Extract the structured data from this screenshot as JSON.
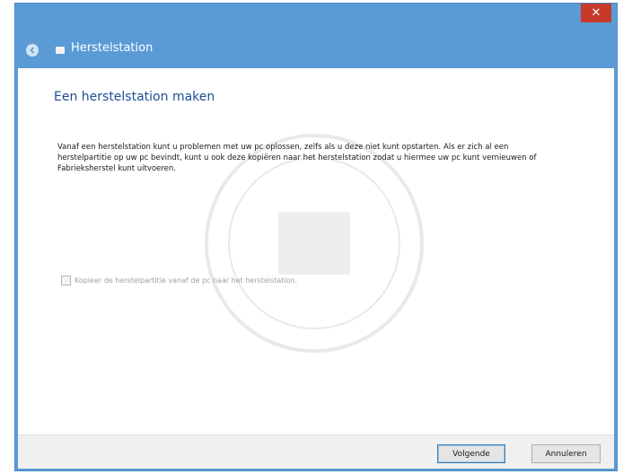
{
  "window": {
    "close_label": "✕"
  },
  "navbar": {
    "title": "Herstelstation",
    "back_icon": "back-arrow-icon",
    "app_icon": "drive-icon"
  },
  "content": {
    "heading": "Een herstelstation maken",
    "description": "Vanaf een herstelstation kunt u problemen met uw pc oplossen, zelfs als u deze niet kunt opstarten. Als er zich al een herstelpartitie op uw pc bevindt, kunt u ook deze kopiëren naar het herstelstation zodat u hiermee uw pc kunt vernieuwen of Fabrieksherstel kunt uitvoeren.",
    "checkbox": {
      "label": "Kopieer de herstelpartitie vanaf de pc naar het herstelstation.",
      "checked": false,
      "enabled": false
    }
  },
  "footer": {
    "next_label": "Volgende",
    "cancel_label": "Annuleren"
  },
  "colors": {
    "window_frame": "#5b9bd5",
    "close_button": "#c7392b",
    "heading": "#1f4e96",
    "footer_bg": "#f0f0f0"
  }
}
